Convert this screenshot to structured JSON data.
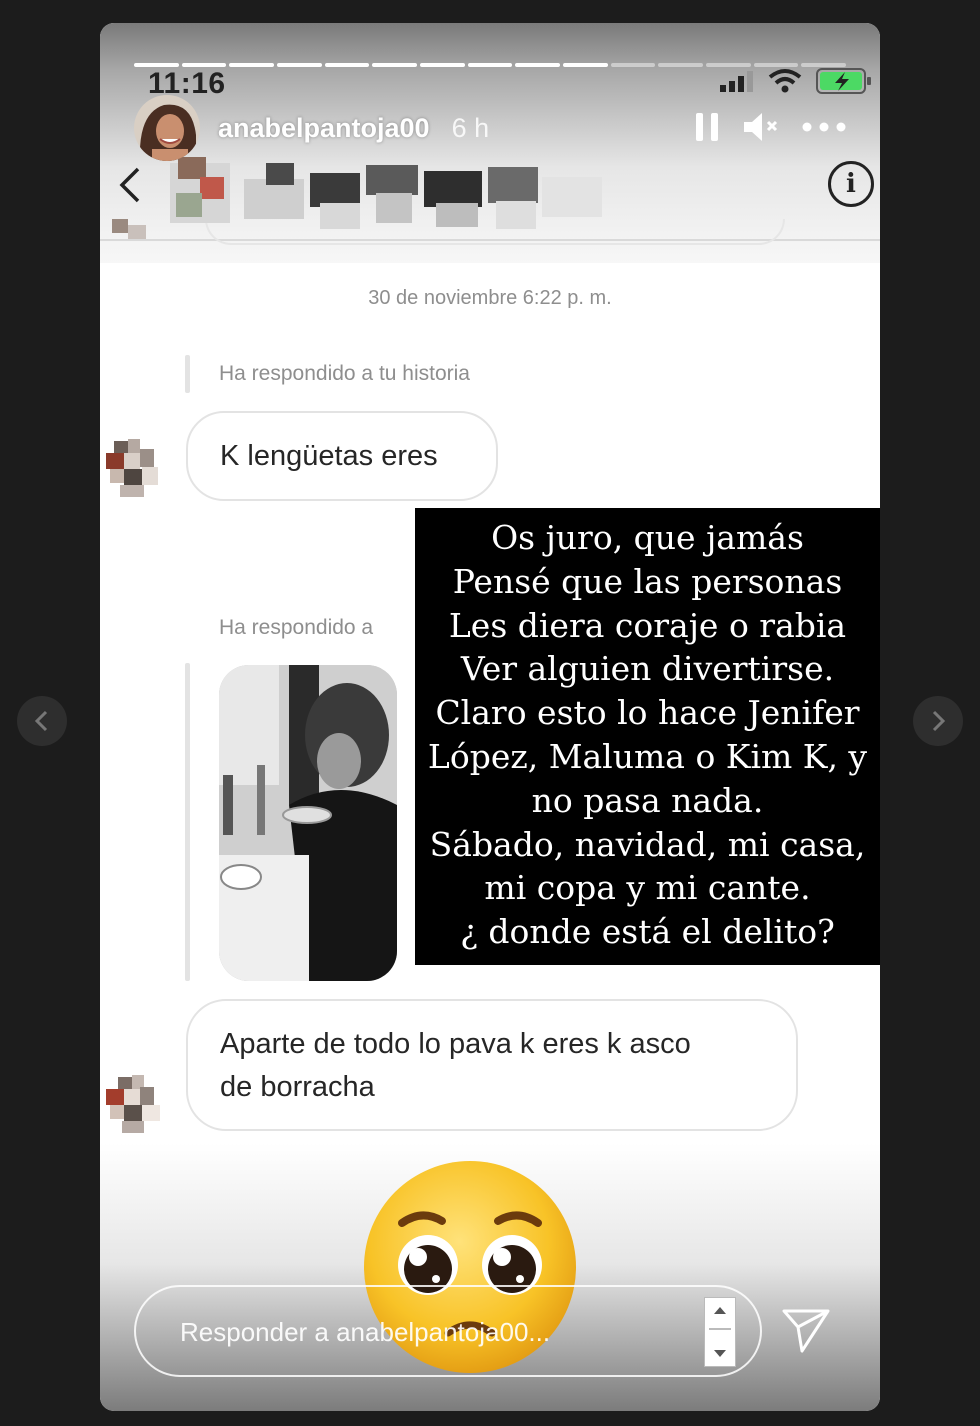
{
  "status_bar": {
    "time": "11:16",
    "icons": [
      "signal-icon",
      "wifi-icon",
      "battery-charging-icon"
    ]
  },
  "story": {
    "progress_segments_total": 15,
    "progress_segments_viewed": 10,
    "username": "anabelpantoja00",
    "age": "6 h",
    "controls": [
      "pause-icon",
      "mute-icon",
      "more-icon"
    ]
  },
  "dm": {
    "timestamp": "30 de noviembre 6:22 p. m.",
    "reply_label_1": "Ha respondido a tu historia",
    "message_1": "K lengüetas eres",
    "reply_label_2": "Ha respondido a",
    "message_2_line_1": "Aparte de todo lo pava k eres k asco",
    "message_2_line_2": "de borracha"
  },
  "overlay_text": [
    "Os juro, que jamás",
    "Pensé que las personas",
    "Les diera coraje o rabia",
    "Ver alguien divertirse.",
    "Claro esto lo hace Jenifer",
    "López, Maluma o Kim K, y",
    "no pasa nada.",
    "Sábado, navidad, mi casa,",
    "mi copa y mi cante.",
    "¿ donde está el delito?"
  ],
  "reply_bar": {
    "placeholder": "Responder a anabelpantoja00..."
  },
  "colors": {
    "page_background": "#1c1c1c",
    "bubble_border": "#e3e3e3",
    "muted_text": "#8e8e8e",
    "battery_green": "#4cd964"
  }
}
